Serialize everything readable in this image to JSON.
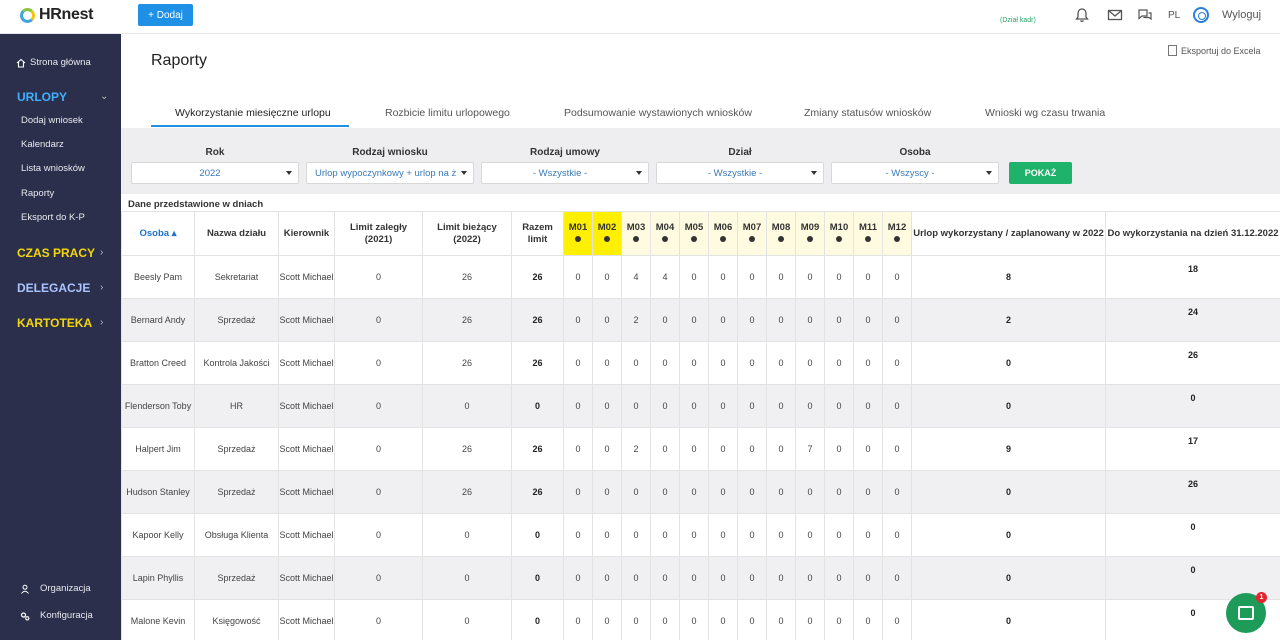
{
  "header": {
    "logo": "HRnest",
    "add_button": "+ Dodaj",
    "department": "(Dział kadr)",
    "language": "PL",
    "logout": "Wyloguj"
  },
  "sidebar": {
    "home": "Strona główna",
    "sections": [
      {
        "label": "URLOPY",
        "color": "#3fb0ff"
      },
      {
        "label": "CZAS PRACY",
        "color": "#f4d70a"
      },
      {
        "label": "DELEGACJE",
        "color": "#a9c4ff"
      },
      {
        "label": "KARTOTEKA",
        "color": "#f4d70a"
      }
    ],
    "urlopy_items": [
      "Dodaj wniosek",
      "Kalendarz",
      "Lista wniosków",
      "Raporty",
      "Eksport do K-P"
    ],
    "organization": "Organizacja",
    "configuration": "Konfiguracja"
  },
  "main": {
    "title": "Raporty",
    "export": "Eksportuj do Excela",
    "tabs": [
      "Wykorzystanie miesięczne urlopu",
      "Rozbicie limitu urlopowego",
      "Podsumowanie wystawionych wniosków",
      "Zmiany statusów wniosków",
      "Wnioski wg czasu trwania"
    ],
    "filters": {
      "year_label": "Rok",
      "year_value": "2022",
      "type_label": "Rodzaj wniosku",
      "type_value": "Urlop wypoczynkowy + urlop na ż",
      "contract_label": "Rodzaj umowy",
      "contract_value": "- Wszystkie -",
      "dept_label": "Dział",
      "dept_value": "- Wszystkie -",
      "person_label": "Osoba",
      "person_value": "- Wszyscy -",
      "show_button": "POKAŻ"
    },
    "data_note": "Dane przedstawione w dniach",
    "table": {
      "headers": {
        "person": "Osoba ▴",
        "dept": "Nazwa działu",
        "manager": "Kierownik",
        "limit_overdue": "Limit zaległy (2021)",
        "limit_current": "Limit bieżący (2022)",
        "total_limit": "Razem limit",
        "months": [
          "M01",
          "M02",
          "M03",
          "M04",
          "M05",
          "M06",
          "M07",
          "M08",
          "M09",
          "M10",
          "M11",
          "M12"
        ],
        "used": "Urlop wykorzystany / zaplanowany w 2022",
        "remaining": "Do wykorzystania na dzień 31.12.2022"
      },
      "rows": [
        {
          "name": "Beesly Pam",
          "dept": "Sekretariat",
          "manager": "Scott Michael",
          "overdue": "0",
          "current": "26",
          "total": "26",
          "months": [
            "0",
            "0",
            "4",
            "4",
            "0",
            "0",
            "0",
            "0",
            "0",
            "0",
            "0",
            "0"
          ],
          "used": "8",
          "remaining": "18"
        },
        {
          "name": "Bernard Andy",
          "dept": "Sprzedaż",
          "manager": "Scott Michael",
          "overdue": "0",
          "current": "26",
          "total": "26",
          "months": [
            "0",
            "0",
            "2",
            "0",
            "0",
            "0",
            "0",
            "0",
            "0",
            "0",
            "0",
            "0"
          ],
          "used": "2",
          "remaining": "24"
        },
        {
          "name": "Bratton Creed",
          "dept": "Kontrola Jakości",
          "manager": "Scott Michael",
          "overdue": "0",
          "current": "26",
          "total": "26",
          "months": [
            "0",
            "0",
            "0",
            "0",
            "0",
            "0",
            "0",
            "0",
            "0",
            "0",
            "0",
            "0"
          ],
          "used": "0",
          "remaining": "26"
        },
        {
          "name": "Flenderson Toby",
          "dept": "HR",
          "manager": "Scott Michael",
          "overdue": "0",
          "current": "0",
          "total": "0",
          "months": [
            "0",
            "0",
            "0",
            "0",
            "0",
            "0",
            "0",
            "0",
            "0",
            "0",
            "0",
            "0"
          ],
          "used": "0",
          "remaining": "0"
        },
        {
          "name": "Halpert Jim",
          "dept": "Sprzedaż",
          "manager": "Scott Michael",
          "overdue": "0",
          "current": "26",
          "total": "26",
          "months": [
            "0",
            "0",
            "2",
            "0",
            "0",
            "0",
            "0",
            "0",
            "7",
            "0",
            "0",
            "0"
          ],
          "used": "9",
          "remaining": "17"
        },
        {
          "name": "Hudson Stanley",
          "dept": "Sprzedaż",
          "manager": "Scott Michael",
          "overdue": "0",
          "current": "26",
          "total": "26",
          "months": [
            "0",
            "0",
            "0",
            "0",
            "0",
            "0",
            "0",
            "0",
            "0",
            "0",
            "0",
            "0"
          ],
          "used": "0",
          "remaining": "26"
        },
        {
          "name": "Kapoor Kelly",
          "dept": "Obsługa Klienta",
          "manager": "Scott Michael",
          "overdue": "0",
          "current": "0",
          "total": "0",
          "months": [
            "0",
            "0",
            "0",
            "0",
            "0",
            "0",
            "0",
            "0",
            "0",
            "0",
            "0",
            "0"
          ],
          "used": "0",
          "remaining": "0"
        },
        {
          "name": "Lapin Phyllis",
          "dept": "Sprzedaż",
          "manager": "Scott Michael",
          "overdue": "0",
          "current": "0",
          "total": "0",
          "months": [
            "0",
            "0",
            "0",
            "0",
            "0",
            "0",
            "0",
            "0",
            "0",
            "0",
            "0",
            "0"
          ],
          "used": "0",
          "remaining": "0"
        },
        {
          "name": "Malone Kevin",
          "dept": "Księgowość",
          "manager": "Scott Michael",
          "overdue": "0",
          "current": "0",
          "total": "0",
          "months": [
            "0",
            "0",
            "0",
            "0",
            "0",
            "0",
            "0",
            "0",
            "0",
            "0",
            "0",
            "0"
          ],
          "used": "0",
          "remaining": "0"
        }
      ]
    }
  },
  "chat": {
    "badge": "1"
  }
}
